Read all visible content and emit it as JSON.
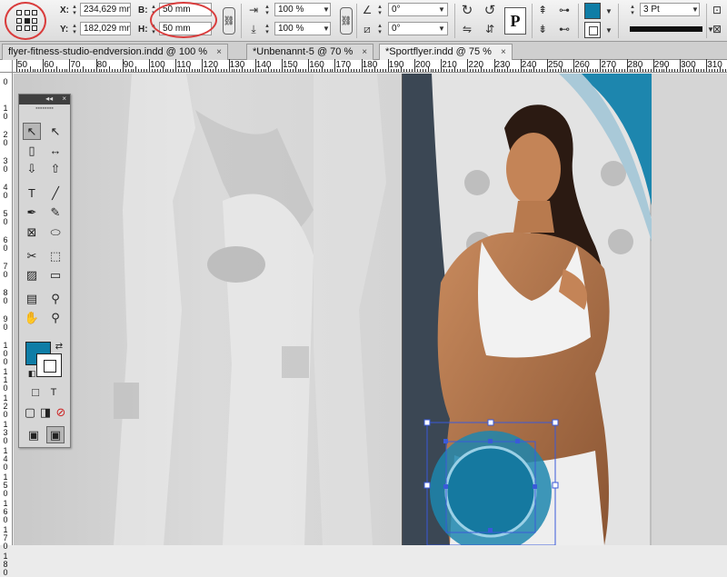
{
  "control_panel": {
    "x_label": "X:",
    "x_value": "234,629 mm",
    "y_label": "Y:",
    "y_value": "182,029 mm",
    "w_label": "B:",
    "w_value": "50 mm",
    "h_label": "H:",
    "h_value": "50 mm",
    "scale_x": "100 %",
    "scale_y": "100 %",
    "rotation": "0°",
    "shear": "0°",
    "fill_color": "#0f7da6",
    "stroke_weight": "3 Pt"
  },
  "tabs": [
    {
      "label": "flyer-fitness-studio-endversion.indd @ 100 %",
      "close": "×"
    },
    {
      "label": "*Unbenannt-5 @ 70 %",
      "close": "×"
    },
    {
      "label": "*Sportflyer.indd @ 75 %",
      "close": "×"
    }
  ],
  "ruler_h": [
    "50",
    "60",
    "70",
    "80",
    "90",
    "100",
    "110",
    "120",
    "130",
    "140",
    "150",
    "160",
    "170",
    "180",
    "190",
    "200",
    "210",
    "220",
    "230",
    "240",
    "250",
    "260",
    "270",
    "280",
    "290",
    "300",
    "310"
  ],
  "ruler_v": [
    "0",
    "1 0",
    "2 0",
    "3 0",
    "4 0",
    "5 0",
    "6 0",
    "7 0",
    "8 0",
    "9 0",
    "1 0 0",
    "1 1 0",
    "1 2 0",
    "1 3 0",
    "1 4 0",
    "1 5 0",
    "1 6 0",
    "1 7 0",
    "1 8 0"
  ],
  "tools_panel": {
    "collapse": "◂◂",
    "close": "×",
    "grip": "▪▪▪▪▪▪▪▪",
    "tools": [
      {
        "name": "selection-tool",
        "glyph": "↖"
      },
      {
        "name": "direct-selection-tool",
        "glyph": "↖"
      },
      {
        "name": "page-tool",
        "glyph": "▯"
      },
      {
        "name": "gap-tool",
        "glyph": "↔"
      },
      {
        "name": "content-collector-tool",
        "glyph": "⇩"
      },
      {
        "name": "content-placer-tool",
        "glyph": "⇧"
      },
      {
        "name": "type-tool",
        "glyph": "T"
      },
      {
        "name": "line-tool",
        "glyph": "╱"
      },
      {
        "name": "pen-tool",
        "glyph": "✒"
      },
      {
        "name": "pencil-tool",
        "glyph": "✎"
      },
      {
        "name": "rectangle-frame-tool",
        "glyph": "⊠"
      },
      {
        "name": "ellipse-tool",
        "glyph": "⬭"
      },
      {
        "name": "scissors-tool",
        "glyph": "✂"
      },
      {
        "name": "free-transform-tool",
        "glyph": "⬚"
      },
      {
        "name": "gradient-swatch-tool",
        "glyph": "▨"
      },
      {
        "name": "gradient-feather-tool",
        "glyph": "▭"
      },
      {
        "name": "note-tool",
        "glyph": "▤"
      },
      {
        "name": "eyedropper-tool",
        "glyph": "⚲"
      },
      {
        "name": "hand-tool",
        "glyph": "✋"
      },
      {
        "name": "zoom-tool",
        "glyph": "⚲"
      }
    ],
    "fill_color": "#0f7da6",
    "format_container": "□",
    "format_text": "T",
    "mode_normal": "▣",
    "mode_preview": "▣"
  }
}
